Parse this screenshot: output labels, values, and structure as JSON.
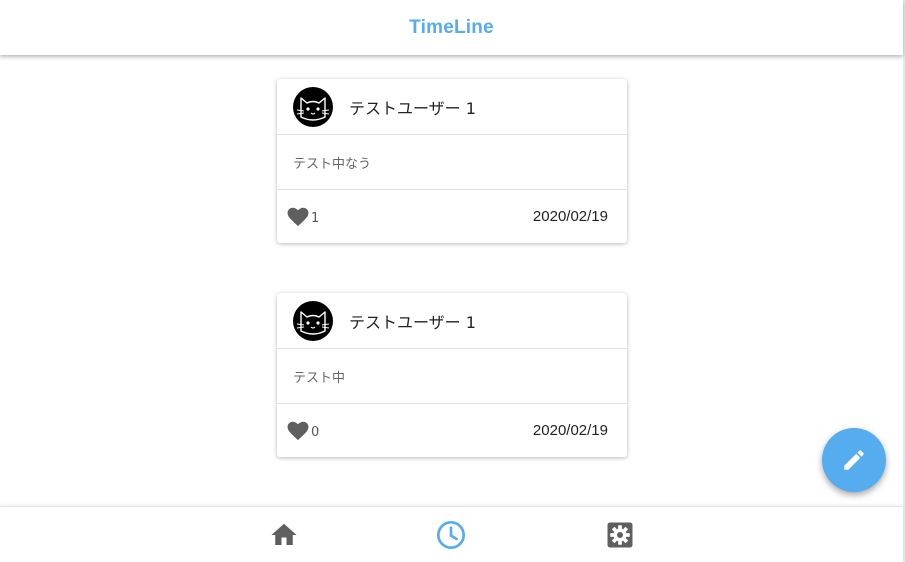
{
  "header": {
    "title": "TimeLine"
  },
  "colors": {
    "accent": "#55acee",
    "icon_gray": "#5f5f5f",
    "avatar_bg": "#000000"
  },
  "posts": [
    {
      "user": "テストユーザー 1",
      "text": "テスト中なう",
      "likes": "1",
      "date": "2020/02/19",
      "avatar_icon": "cat-face-icon"
    },
    {
      "user": "テストユーザー 1",
      "text": "テスト中",
      "likes": "0",
      "date": "2020/02/19",
      "avatar_icon": "cat-face-icon"
    }
  ],
  "fab": {
    "icon": "pencil-icon"
  },
  "bottom_nav": {
    "items": [
      {
        "name": "home",
        "icon": "home-icon",
        "active": false
      },
      {
        "name": "timeline",
        "icon": "clock-icon",
        "active": true
      },
      {
        "name": "settings",
        "icon": "gear-icon",
        "active": false
      }
    ]
  }
}
